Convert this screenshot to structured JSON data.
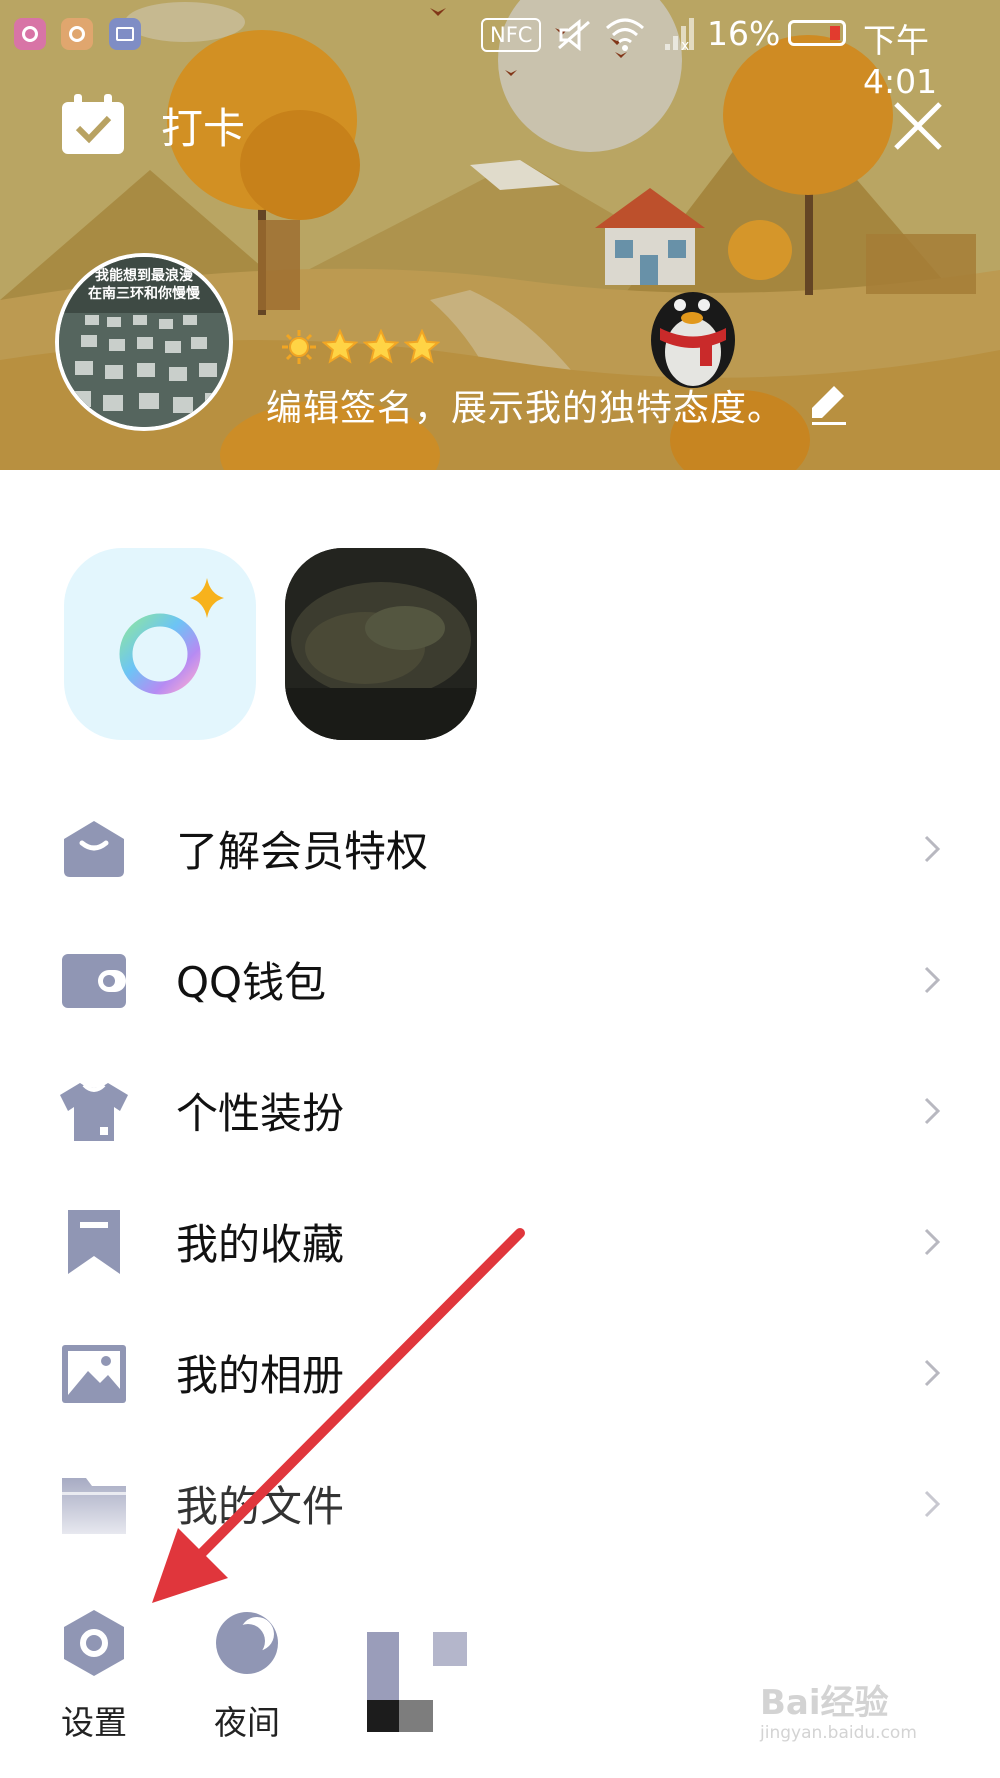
{
  "status_bar": {
    "nfc_label": "NFC",
    "battery_percent": "16%",
    "time": "下午4:01",
    "battery_level": 0.16,
    "notification_icons": [
      "camera-app-icon",
      "browser-app-icon",
      "gallery-app-icon"
    ],
    "status_icons": [
      "mute-icon",
      "wifi-icon",
      "signal-icon"
    ]
  },
  "header": {
    "checkin_label": "打卡",
    "avatar_caption_line1": "我能想到最浪漫",
    "avatar_caption_line2": "在南三环和你慢慢",
    "level_icons": [
      "sun-icon",
      "star-icon",
      "star-icon",
      "star-icon"
    ],
    "signature": "编辑签名，展示我的独特态度。"
  },
  "shortcuts": [
    {
      "name": "ring-app-tile",
      "icon": "color-ring-icon"
    },
    {
      "name": "photo-tile",
      "icon": "photo-thumbnail"
    }
  ],
  "menu": {
    "items": [
      {
        "label": "了解会员特权",
        "icon": "vip-crown-icon"
      },
      {
        "label": "QQ钱包",
        "icon": "wallet-icon"
      },
      {
        "label": "个性装扮",
        "icon": "shirt-icon"
      },
      {
        "label": "我的收藏",
        "icon": "bookmark-icon"
      },
      {
        "label": "我的相册",
        "icon": "picture-icon"
      },
      {
        "label": "我的文件",
        "icon": "folder-icon"
      }
    ]
  },
  "bottom_bar": {
    "settings_label": "设置",
    "night_label": "夜间"
  },
  "colors": {
    "icon_gray": "#9096b4",
    "arrow_red": "#e0363c",
    "banner_ochre": "#c4b26e"
  },
  "watermark": {
    "brand": "Bai经验",
    "url": "jingyan.baidu.com"
  }
}
